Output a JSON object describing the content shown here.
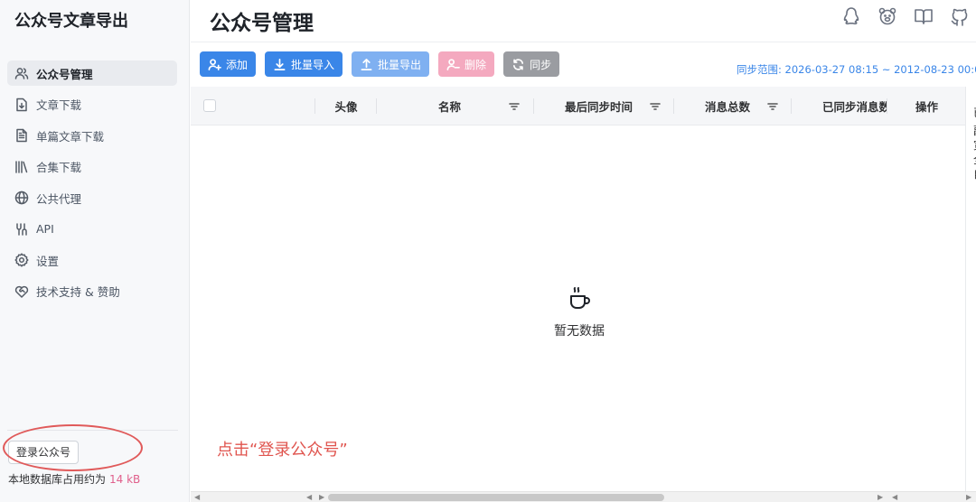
{
  "app": {
    "title": "公众号文章导出"
  },
  "sidebar": {
    "items": [
      {
        "label": "公众号管理",
        "icon": "users-icon",
        "active": true
      },
      {
        "label": "文章下载",
        "icon": "file-download-icon",
        "active": false
      },
      {
        "label": "单篇文章下载",
        "icon": "file-text-icon",
        "active": false
      },
      {
        "label": "合集下载",
        "icon": "library-icon",
        "active": false
      },
      {
        "label": "公共代理",
        "icon": "globe-icon",
        "active": false
      },
      {
        "label": "API",
        "icon": "api-icon",
        "active": false
      },
      {
        "label": "设置",
        "icon": "gear-icon",
        "active": false
      },
      {
        "label": "技术支持 & 赞助",
        "icon": "heart-handshake-icon",
        "active": false
      }
    ],
    "login_button": "登录公众号",
    "storage_label": "本地数据库占用约为",
    "storage_size": "14 kB"
  },
  "header": {
    "title": "公众号管理",
    "icons": [
      "qq-icon",
      "bear-icon",
      "book-icon",
      "github-icon"
    ]
  },
  "toolbar": {
    "add": "添加",
    "batch_import": "批量导入",
    "batch_export": "批量导出",
    "delete": "删除",
    "sync": "同步",
    "sync_range": "同步范围: 2026-03-27 08:15 ~ 2012-08-23 00:0"
  },
  "table": {
    "columns": [
      "头像",
      "名称",
      "最后同步时间",
      "消息总数",
      "已同步消息数",
      "操作"
    ],
    "empty_text": "暂无数据"
  },
  "right_edge_chars": [
    "已",
    "副",
    "宽",
    "全",
    "自"
  ],
  "annotation": "点击“登录公众号”",
  "colors": {
    "primary": "#3a86e8",
    "danger": "#f4a9bf",
    "annotation": "#e0554f"
  }
}
